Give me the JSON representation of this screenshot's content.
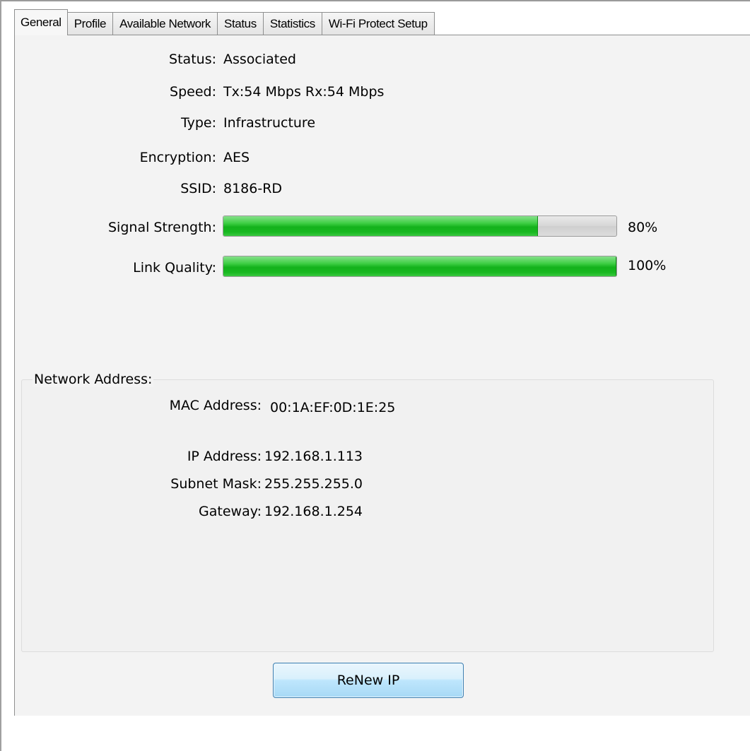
{
  "tabs": [
    {
      "label": "General",
      "active": true
    },
    {
      "label": "Profile",
      "active": false
    },
    {
      "label": "Available Network",
      "active": false
    },
    {
      "label": "Status",
      "active": false
    },
    {
      "label": "Statistics",
      "active": false
    },
    {
      "label": "Wi-Fi Protect Setup",
      "active": false
    }
  ],
  "general": {
    "status": {
      "label": "Status:",
      "value": "Associated"
    },
    "speed": {
      "label": "Speed:",
      "value": "Tx:54 Mbps Rx:54 Mbps"
    },
    "type": {
      "label": "Type:",
      "value": "Infrastructure"
    },
    "encryption": {
      "label": "Encryption:",
      "value": "AES"
    },
    "ssid": {
      "label": "SSID:",
      "value": "8186-RD"
    },
    "signal_strength": {
      "label": "Signal Strength:",
      "percent": 80,
      "percent_text": "80%"
    },
    "link_quality": {
      "label": "Link Quality:",
      "percent": 100,
      "percent_text": "100%"
    }
  },
  "network_address": {
    "title": "Network Address:",
    "mac": {
      "label": "MAC Address:",
      "value": "00:1A:EF:0D:1E:25"
    },
    "ip": {
      "label": "IP Address:",
      "value": "192.168.1.113"
    },
    "subnet": {
      "label": "Subnet Mask:",
      "value": "255.255.255.0"
    },
    "gateway": {
      "label": "Gateway:",
      "value": "192.168.1.254"
    }
  },
  "buttons": {
    "renew_ip": "ReNew IP"
  },
  "colors": {
    "progress_fill": "#13b21b",
    "button_border": "#3c7fb1"
  }
}
